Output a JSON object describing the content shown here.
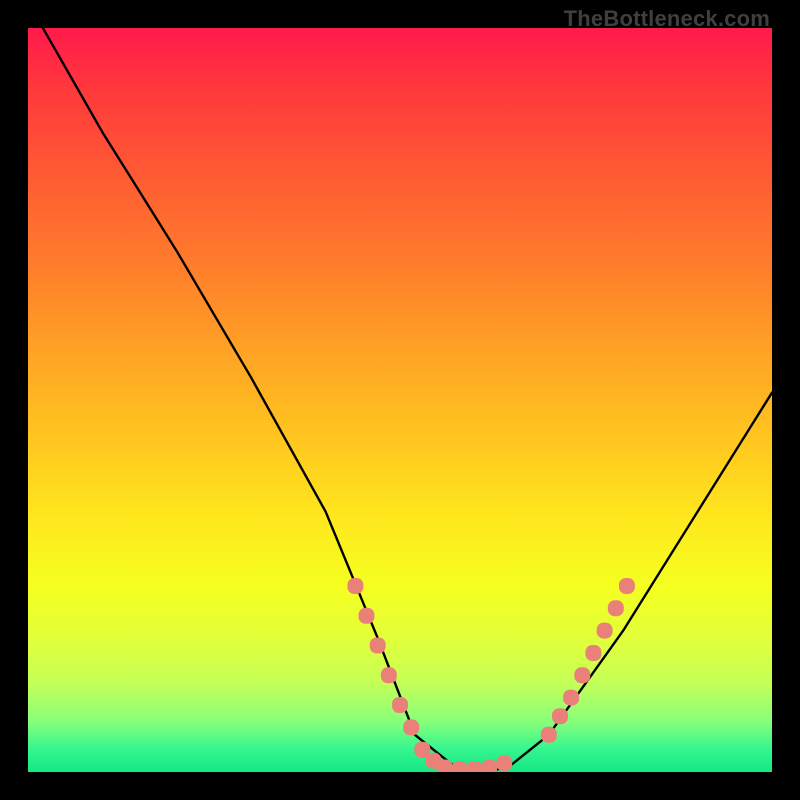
{
  "watermark": "TheBottleneck.com",
  "chart_data": {
    "type": "line",
    "title": "",
    "xlabel": "",
    "ylabel": "",
    "xlim": [
      0,
      100
    ],
    "ylim": [
      0,
      100
    ],
    "series": [
      {
        "name": "curve",
        "x": [
          2,
          10,
          20,
          30,
          40,
          47,
          52,
          57,
          62,
          65,
          70,
          80,
          90,
          100
        ],
        "y": [
          100,
          86,
          70,
          53,
          35,
          18,
          5,
          1,
          0,
          1,
          5,
          19,
          35,
          51
        ],
        "color": "#000000"
      },
      {
        "name": "markers-left",
        "x": [
          44,
          45.5,
          47,
          48.5,
          50,
          51.5,
          53,
          54.5
        ],
        "y": [
          25,
          21,
          17,
          13,
          9,
          6,
          3,
          1.5
        ],
        "color": "#e98179"
      },
      {
        "name": "markers-bottom",
        "x": [
          56,
          58,
          60,
          62,
          64
        ],
        "y": [
          0.6,
          0.4,
          0.4,
          0.6,
          1.2
        ],
        "color": "#e98179"
      },
      {
        "name": "markers-right",
        "x": [
          70,
          71.5,
          73,
          74.5,
          76,
          77.5,
          79,
          80.5
        ],
        "y": [
          5,
          7.5,
          10,
          13,
          16,
          19,
          22,
          25
        ],
        "color": "#e98179"
      }
    ]
  }
}
